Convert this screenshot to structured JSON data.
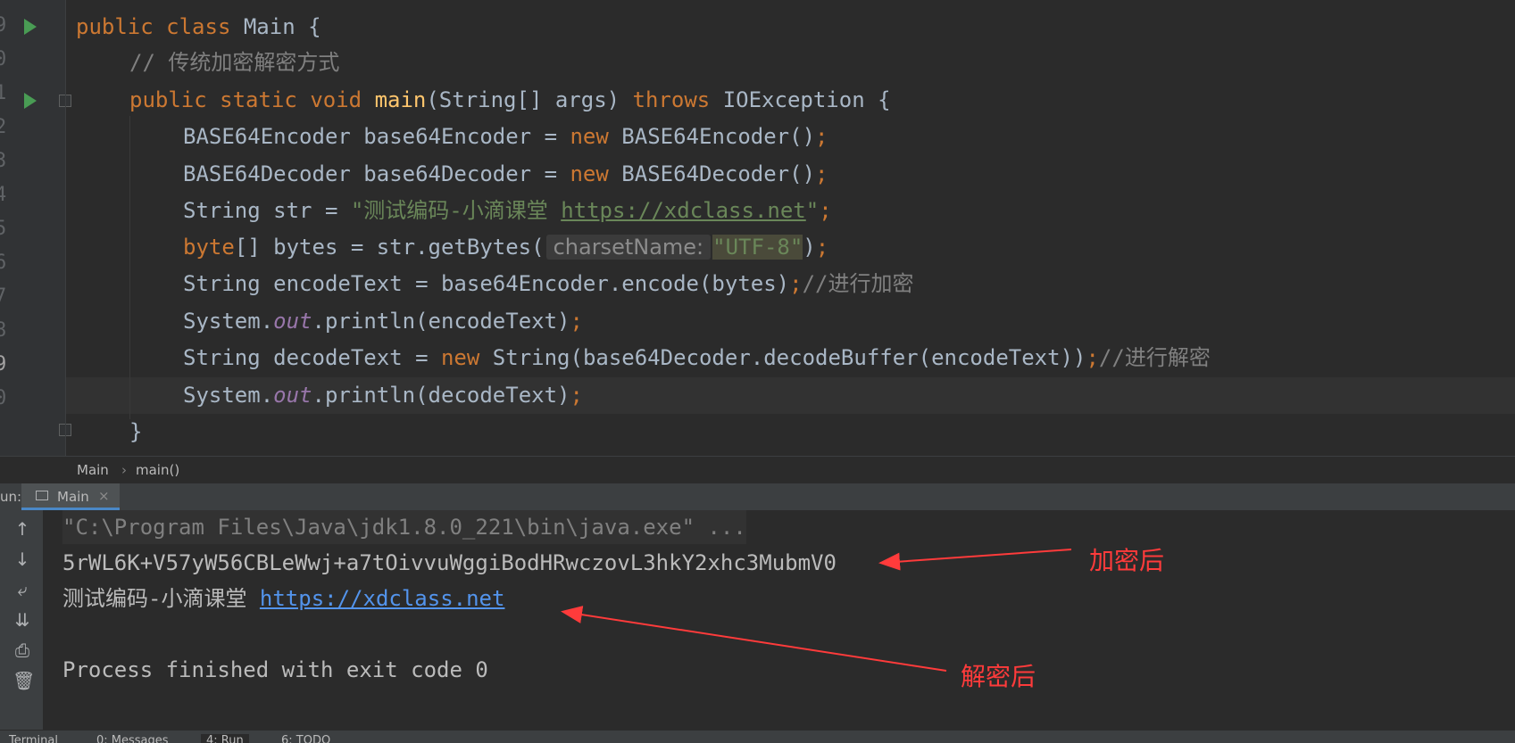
{
  "editor": {
    "line_numbers": [
      "9",
      "0",
      "1",
      "2",
      "3",
      "4",
      "5",
      "6",
      "7",
      "8",
      "9",
      "0"
    ],
    "lines": {
      "l1": {
        "kw1": "public",
        "kw2": "class",
        "name": "Main",
        "brace": " {"
      },
      "l2": {
        "comment": "// 传统加密解密方式"
      },
      "l3": {
        "kw1": "public",
        "kw2": "static",
        "kw3": "void",
        "fn": "main",
        "params": "(String[] args) ",
        "kw4": "throws",
        "rest": " IOException {"
      },
      "l4": {
        "a": "BASE64Encoder base64Encoder = ",
        "kw": "new",
        "b": " BASE64Encoder()",
        "semi": ";"
      },
      "l5": {
        "a": "BASE64Decoder base64Decoder = ",
        "kw": "new",
        "b": " BASE64Decoder()",
        "semi": ";"
      },
      "l6": {
        "a": "String str = ",
        "str": "\"测试编码-小滴课堂 ",
        "link": "https://xdclass.net",
        "strend": "\"",
        "semi": ";"
      },
      "l7": {
        "kw": "byte",
        "a": "[] bytes = str.getBytes(",
        "hint": "charsetName:",
        "str": "\"UTF-8\"",
        "b": ")",
        "semi": ";"
      },
      "l8": {
        "a": "String encodeText = base64Encoder.encode(bytes)",
        "semi": ";",
        "comment": "//进行加密"
      },
      "l9": {
        "a": "System.",
        "field": "out",
        "b": ".println(encodeText)",
        "semi": ";"
      },
      "l10": {
        "a": "String decodeText = ",
        "kw": "new",
        "b": " String(base64Decoder.decodeBuffer(encodeText))",
        "semi": ";",
        "comment": "//进行解密"
      },
      "l11": {
        "a": "System.",
        "field": "out",
        "b": ".println(decodeText)",
        "semi": ";"
      },
      "l12": {
        "a": "}"
      }
    }
  },
  "breadcrumb": {
    "class_name": "Main",
    "separator": "›",
    "method_name": "main()"
  },
  "run_panel": {
    "label": "un:",
    "tab_label": "Main",
    "tab_close": "×",
    "output": {
      "command": "\"C:\\Program Files\\Java\\jdk1.8.0_221\\bin\\java.exe\" ...",
      "encoded": "5rWL6K+V57yW56CBLeWwj+a7tOivvuWggiBodHRwczovL3hkY2xhc3MubmV0",
      "decoded_text": "测试编码-小滴课堂 ",
      "decoded_link": "https://xdclass.net",
      "exit": "Process finished with exit code 0"
    },
    "toolbar_icons": [
      "arrow-up-icon",
      "arrow-down-icon",
      "soft-wrap-icon",
      "scroll-to-end-icon",
      "print-icon",
      "trash-icon"
    ]
  },
  "annotations": {
    "encrypted_label": "加密后",
    "decrypted_label": "解密后",
    "color": "#ff3b3b"
  },
  "bottom_tabs": [
    "Terminal",
    "0: Messages",
    "4: Run",
    "6: TODO"
  ],
  "colors": {
    "keyword": "#cc7832",
    "string": "#6a8759",
    "comment": "#808080",
    "function": "#ffc66d",
    "field": "#9876aa",
    "link": "#5394ec"
  }
}
